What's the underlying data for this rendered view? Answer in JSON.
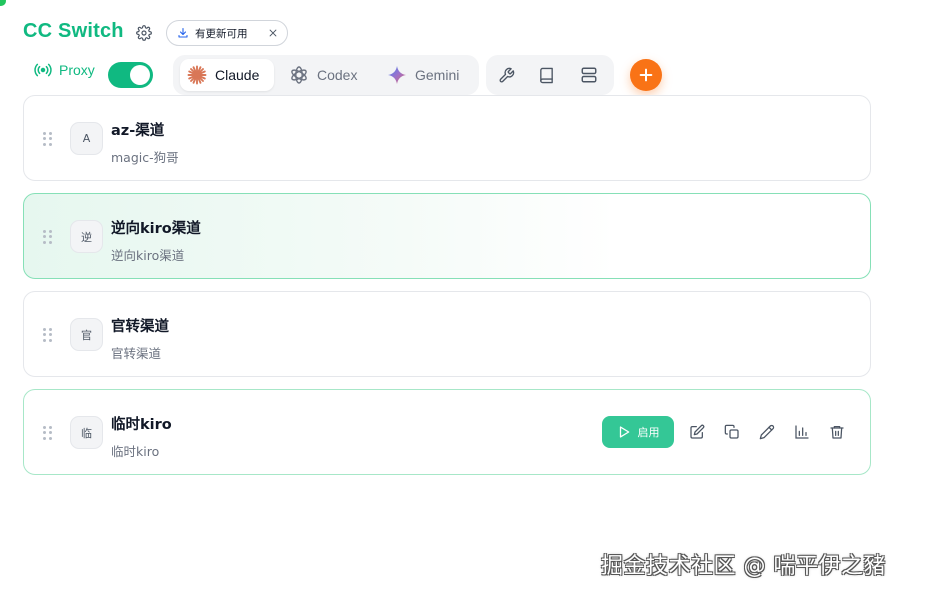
{
  "app": {
    "title": "CC Switch"
  },
  "header": {
    "update_notice": "有更新可用"
  },
  "proxy": {
    "label": "Proxy",
    "enabled": true
  },
  "tabs": [
    {
      "label": "Claude",
      "icon": "claude-icon",
      "active": true
    },
    {
      "label": "Codex",
      "icon": "openai-icon",
      "active": false
    },
    {
      "label": "Gemini",
      "icon": "gemini-icon",
      "active": false
    }
  ],
  "toolbar": {
    "icons": [
      "wrench-icon",
      "book-icon",
      "server-icon",
      "plus-icon"
    ]
  },
  "providers": [
    {
      "avatar": "A",
      "name": "az-渠道",
      "subtitle": "magic-狗哥",
      "state": "normal"
    },
    {
      "avatar": "逆",
      "name": "逆向kiro渠道",
      "subtitle": "逆向kiro渠道",
      "state": "active"
    },
    {
      "avatar": "官",
      "name": "官转渠道",
      "subtitle": "官转渠道",
      "state": "normal"
    },
    {
      "avatar": "临",
      "name": "临时kiro",
      "subtitle": "临时kiro",
      "state": "hover"
    }
  ],
  "card_actions": {
    "enable_label": "启用",
    "icons": [
      "play-icon",
      "edit-icon",
      "copy-icon",
      "pen-icon",
      "bar-chart-icon",
      "trash-icon"
    ]
  },
  "watermark": "掘金技术社区 @ 喘平伊之豬",
  "colors": {
    "brand": "#10b981",
    "accent": "#f97316",
    "enable_button": "#34c796"
  }
}
